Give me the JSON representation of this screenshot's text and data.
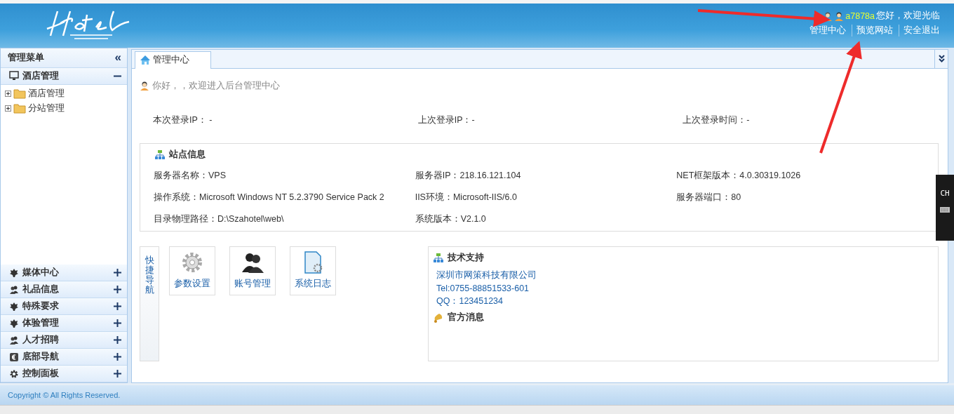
{
  "header": {
    "username": "a7878a",
    "welcome": "您好，欢迎光临",
    "links": [
      {
        "label": "管理中心"
      },
      {
        "label": "预览网站"
      },
      {
        "label": "安全退出"
      }
    ]
  },
  "sidebar": {
    "title": "管理菜单",
    "collapse": "«",
    "sections": [
      {
        "label": "酒店管理",
        "expanded": true,
        "children": [
          {
            "label": "酒店管理"
          },
          {
            "label": "分站管理"
          }
        ]
      },
      {
        "label": "媒体中心",
        "expanded": false
      },
      {
        "label": "礼品信息",
        "expanded": false
      },
      {
        "label": "特殊要求",
        "expanded": false
      },
      {
        "label": "体验管理",
        "expanded": false
      },
      {
        "label": "人才招聘",
        "expanded": false
      },
      {
        "label": "底部导航",
        "expanded": false
      },
      {
        "label": "控制面板",
        "expanded": false
      }
    ]
  },
  "tabs": [
    {
      "label": "管理中心",
      "selected": true
    }
  ],
  "greeting": "你好，，欢迎进入后台管理中心",
  "login_info": [
    "本次登录IP： -",
    "上次登录IP：-",
    "上次登录时间：-"
  ],
  "site_info": {
    "title": "站点信息",
    "items": [
      "服务器名称：VPS",
      "服务器IP：218.16.121.104",
      "NET框架版本：4.0.30319.1026",
      "操作系统：Microsoft Windows NT 5.2.3790 Service Pack 2",
      "IIS环境：Microsoft-IIS/6.0",
      "服务器端口：80",
      "目录物理路径：D:\\Szahotel\\web\\",
      "系统版本：V2.1.0"
    ]
  },
  "quick_nav": {
    "title": "快捷导航",
    "buttons": [
      {
        "label": "参数设置"
      },
      {
        "label": "账号管理"
      },
      {
        "label": "系统日志"
      }
    ]
  },
  "support": {
    "title": "技术支持",
    "lines": [
      "深圳市网策科技有限公司",
      "Tel:0755-88851533-601",
      "QQ：123451234"
    ],
    "news_title": "官方消息"
  },
  "footer": {
    "copyright": "Copyright © All Rights Reserved."
  },
  "ime": {
    "label": "CH"
  }
}
